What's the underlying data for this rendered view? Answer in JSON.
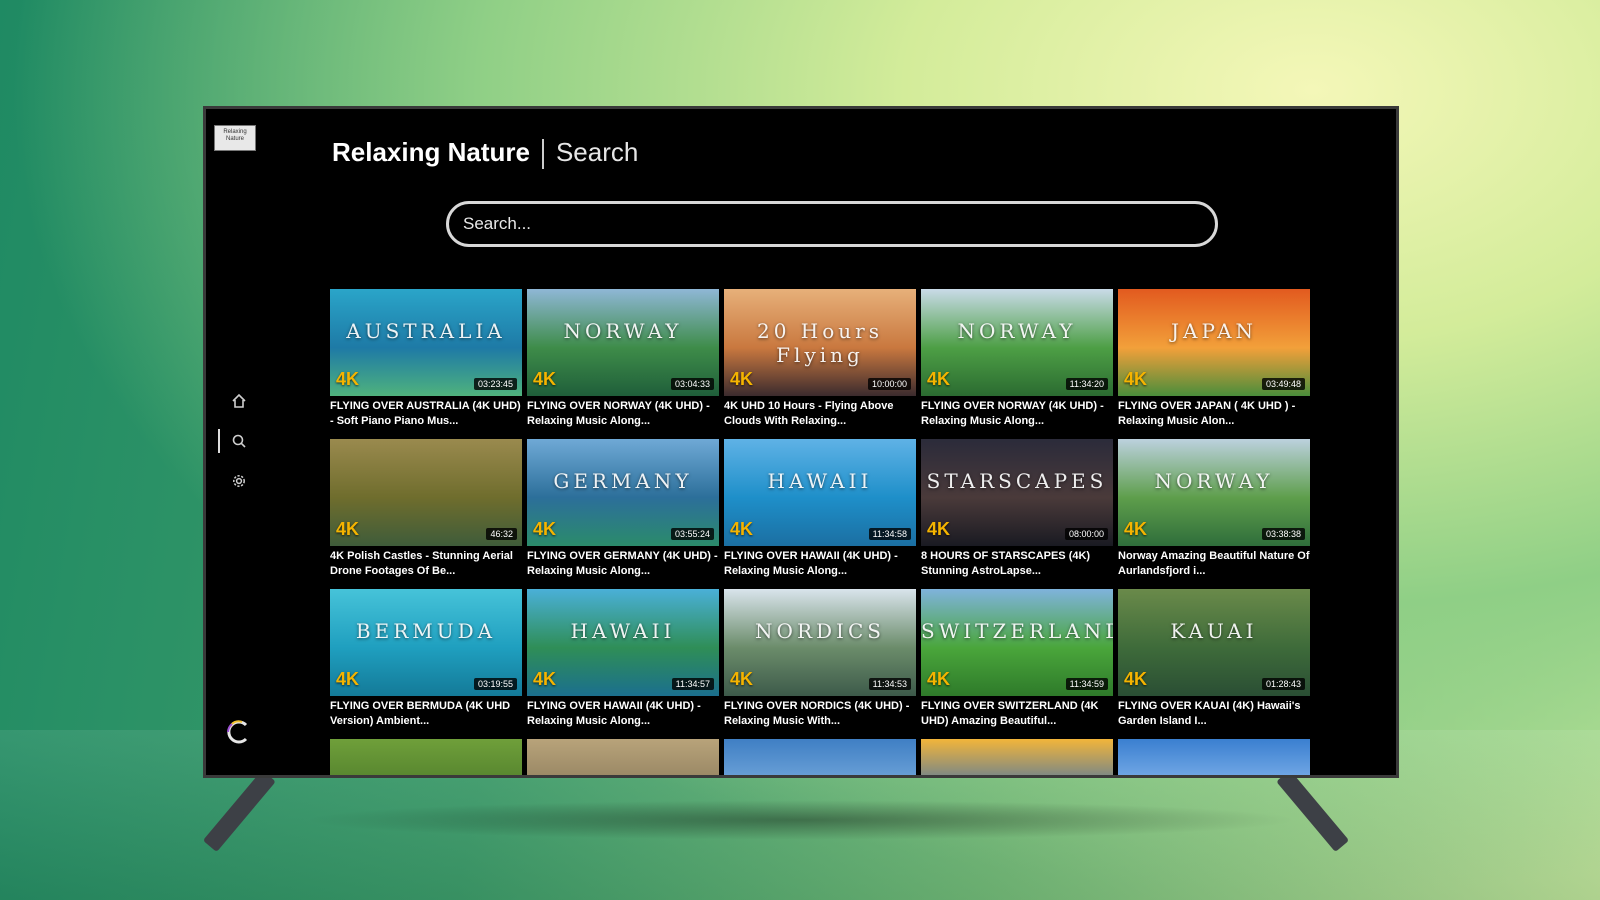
{
  "app": {
    "logo_text": "Relaxing Nature",
    "name": "Relaxing Nature",
    "page": "Search"
  },
  "search": {
    "placeholder": "Search..."
  },
  "nav": [
    {
      "icon": "home-icon",
      "active": false
    },
    {
      "icon": "search-icon",
      "active": true
    },
    {
      "icon": "gear-icon",
      "active": false
    }
  ],
  "videos": [
    {
      "overlay": "AUSTRALIA",
      "badge": "4K",
      "duration": "03:23:45",
      "label": "FLYING OVER AUSTRALIA (4K UHD) - Soft Piano Piano Mus...",
      "colors": [
        "#2aa5c9",
        "#1e7aa6",
        "#4fb27d"
      ]
    },
    {
      "overlay": "NORWAY",
      "badge": "4K",
      "duration": "03:04:33",
      "label": "FLYING OVER NORWAY (4K UHD) - Relaxing Music Along...",
      "colors": [
        "#8fb7d6",
        "#3e8c49",
        "#1f5e3a"
      ]
    },
    {
      "overlay": "20 Hours Flying",
      "badge": "4K",
      "duration": "10:00:00",
      "label": "4K UHD 10 Hours - Flying Above Clouds With Relaxing...",
      "colors": [
        "#e7b07a",
        "#c9783f",
        "#3b2b2e"
      ]
    },
    {
      "overlay": "NORWAY",
      "badge": "4K",
      "duration": "11:34:20",
      "label": "FLYING OVER NORWAY (4K UHD) - Relaxing Music Along...",
      "colors": [
        "#c9dbe8",
        "#4d9f45",
        "#2b6b31"
      ]
    },
    {
      "overlay": "JAPAN",
      "badge": "4K",
      "duration": "03:49:48",
      "label": "FLYING OVER JAPAN ( 4K UHD ) - Relaxing Music Alon...",
      "colors": [
        "#e25a1f",
        "#f2a03a",
        "#4a8d3b"
      ]
    },
    {
      "overlay": "",
      "badge": "4K",
      "duration": "46:32",
      "label": "4K Polish Castles - Stunning Aerial Drone Footages Of Be...",
      "colors": [
        "#9a8a4e",
        "#6f6d2d",
        "#3f5c3a"
      ]
    },
    {
      "overlay": "GERMANY",
      "badge": "4K",
      "duration": "03:55:24",
      "label": "FLYING OVER GERMANY (4K UHD) - Relaxing Music Along...",
      "colors": [
        "#6fa9d6",
        "#2c6f9a",
        "#2b8b6b"
      ]
    },
    {
      "overlay": "HAWAII",
      "badge": "4K",
      "duration": "11:34:58",
      "label": "FLYING OVER HAWAII (4K UHD) - Relaxing Music Along...",
      "colors": [
        "#5fb2e6",
        "#1e8fc9",
        "#1b6fa2"
      ]
    },
    {
      "overlay": "STARSCAPES",
      "badge": "4K",
      "duration": "08:00:00",
      "label": "8 HOURS OF STARSCAPES (4K) Stunning AstroLapse...",
      "colors": [
        "#2b2b3a",
        "#4a3a3a",
        "#1a1a22"
      ]
    },
    {
      "overlay": "NORWAY",
      "badge": "4K",
      "duration": "03:38:38",
      "label": "Norway Amazing Beautiful Nature Of Aurlandsfjord i...",
      "colors": [
        "#bcd1de",
        "#5e9e4b",
        "#2f6e3b"
      ]
    },
    {
      "overlay": "BERMUDA",
      "badge": "4K",
      "duration": "03:19:55",
      "label": "FLYING OVER BERMUDA (4K UHD Version) Ambient...",
      "colors": [
        "#46c3d9",
        "#1f9fbf",
        "#147a98"
      ]
    },
    {
      "overlay": "HAWAII",
      "badge": "4K",
      "duration": "11:34:57",
      "label": "FLYING OVER HAWAII (4K UHD) - Relaxing Music Along...",
      "colors": [
        "#4ab0d8",
        "#2f8e57",
        "#1b6f8e"
      ]
    },
    {
      "overlay": "NORDICS",
      "badge": "4K",
      "duration": "11:34:53",
      "label": "FLYING OVER NORDICS (4K UHD) - Relaxing Music With...",
      "colors": [
        "#d9e4ec",
        "#6b8c6a",
        "#3d5a4a"
      ]
    },
    {
      "overlay": "SWITZERLAND",
      "badge": "4K",
      "duration": "11:34:59",
      "label": "FLYING OVER SWITZERLAND (4K UHD) Amazing Beautiful...",
      "colors": [
        "#7fb3dc",
        "#4aa63b",
        "#2e7a2a"
      ]
    },
    {
      "overlay": "KAUAI",
      "badge": "4K",
      "duration": "01:28:43",
      "label": "FLYING OVER KAUAI (4K) Hawaii's Garden Island I...",
      "colors": [
        "#6a8a4a",
        "#3e6b3a",
        "#2a4e34"
      ]
    },
    {
      "overlay": "",
      "badge": "",
      "duration": "",
      "label": "",
      "colors": [
        "#6f9f3a",
        "#4c7a2a",
        "#2e5a24"
      ]
    },
    {
      "overlay": "",
      "badge": "",
      "duration": "",
      "label": "",
      "colors": [
        "#b8a37a",
        "#8a7a5a",
        "#5a4e3a"
      ]
    },
    {
      "overlay": "",
      "badge": "",
      "duration": "",
      "label": "",
      "colors": [
        "#3f7fc4",
        "#7fb0e0",
        "#2a5d9a"
      ]
    },
    {
      "overlay": "",
      "badge": "",
      "duration": "",
      "label": "",
      "colors": [
        "#f2b53a",
        "#3a6fb0",
        "#1f4d8a"
      ]
    },
    {
      "overlay": "",
      "badge": "",
      "duration": "",
      "label": "",
      "colors": [
        "#3a7fd0",
        "#8fbdf0",
        "#2a5fa8"
      ]
    }
  ]
}
